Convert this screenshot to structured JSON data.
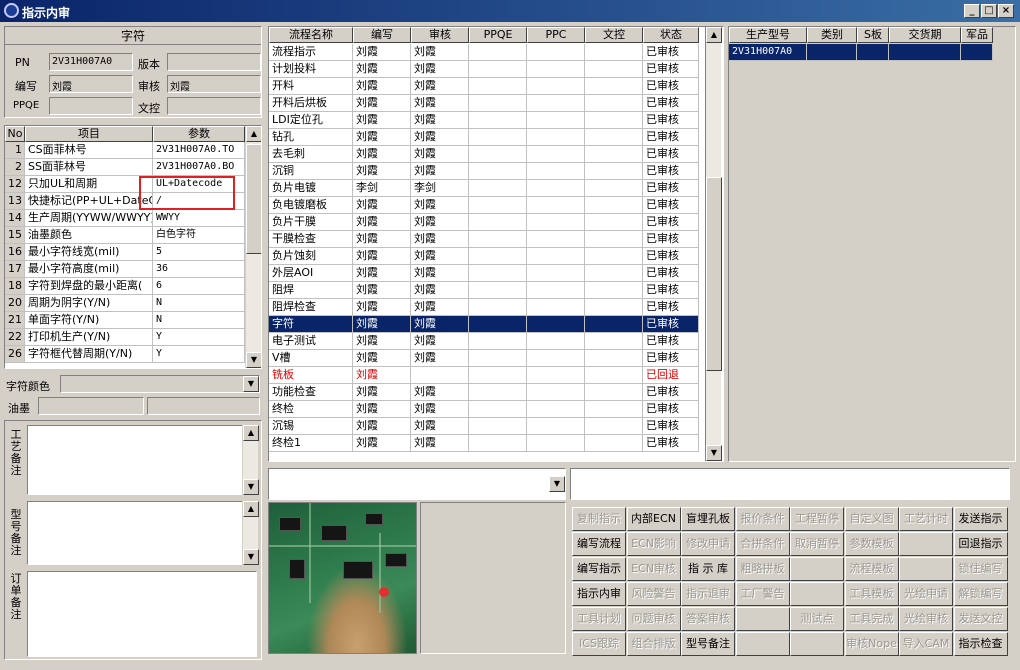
{
  "window": {
    "title": "指示内审",
    "buttons": [
      "_",
      "□",
      "×"
    ]
  },
  "header": {
    "section_title": "字符",
    "pn_label": "PN",
    "pn_value": "2V31H007A0",
    "version_label": "版本",
    "version_value": "",
    "author_label": "编写",
    "author_value": "刘霞",
    "review_label": "审核",
    "review_value": "刘霞",
    "ppqe_label": "PPQE",
    "ppqe_value": "",
    "doc_label": "文控",
    "doc_value": ""
  },
  "params": {
    "columns": [
      "No",
      "项目",
      "参数"
    ],
    "rows": [
      {
        "no": "1",
        "item": "CS面菲林号",
        "value": "2V31H007A0.TO"
      },
      {
        "no": "2",
        "item": "SS面菲林号",
        "value": "2V31H007A0.BO"
      },
      {
        "no": "12",
        "item": "只加UL和周期",
        "value": "UL+Datecode"
      },
      {
        "no": "13",
        "item": "快捷标记(PP+UL+DateCo",
        "value": "/"
      },
      {
        "no": "14",
        "item": "生产周期(YYWW/WWYY)",
        "value": "WWYY"
      },
      {
        "no": "15",
        "item": "油墨颜色",
        "value": "白色字符"
      },
      {
        "no": "16",
        "item": "最小字符线宽(mil)",
        "value": "5"
      },
      {
        "no": "17",
        "item": "最小字符高度(mil)",
        "value": "36"
      },
      {
        "no": "18",
        "item": "字符到焊盘的最小距离(",
        "value": "6"
      },
      {
        "no": "20",
        "item": "周期为阴字(Y/N)",
        "value": "N"
      },
      {
        "no": "21",
        "item": "单面字符(Y/N)",
        "value": "N"
      },
      {
        "no": "22",
        "item": "打印机生产(Y/N)",
        "value": "Y"
      },
      {
        "no": "26",
        "item": "字符框代替周期(Y/N)",
        "value": "Y"
      }
    ]
  },
  "char_color": {
    "label": "字符颜色",
    "value": ""
  },
  "ink": {
    "label": "油墨",
    "value1": "",
    "value2": ""
  },
  "notes": {
    "process": "工艺备注",
    "model": "型号备注",
    "order": "订单备注"
  },
  "process": {
    "columns": [
      "流程名称",
      "编写",
      "审核",
      "PPQE",
      "PPC",
      "文控",
      "状态"
    ],
    "rows": [
      {
        "name": "流程指示",
        "author": "刘霞",
        "review": "刘霞",
        "status": "已审核"
      },
      {
        "name": "计划投料",
        "author": "刘霞",
        "review": "刘霞",
        "status": "已审核"
      },
      {
        "name": "开料",
        "author": "刘霞",
        "review": "刘霞",
        "status": "已审核"
      },
      {
        "name": "开料后烘板",
        "author": "刘霞",
        "review": "刘霞",
        "status": "已审核"
      },
      {
        "name": "LDI定位孔",
        "author": "刘霞",
        "review": "刘霞",
        "status": "已审核"
      },
      {
        "name": "钻孔",
        "author": "刘霞",
        "review": "刘霞",
        "status": "已审核"
      },
      {
        "name": "去毛刺",
        "author": "刘霞",
        "review": "刘霞",
        "status": "已审核"
      },
      {
        "name": "沉铜",
        "author": "刘霞",
        "review": "刘霞",
        "status": "已审核"
      },
      {
        "name": "负片电镀",
        "author": "李剑",
        "review": "李剑",
        "status": "已审核"
      },
      {
        "name": "负电镀磨板",
        "author": "刘霞",
        "review": "刘霞",
        "status": "已审核"
      },
      {
        "name": "负片干膜",
        "author": "刘霞",
        "review": "刘霞",
        "status": "已审核"
      },
      {
        "name": "干膜检查",
        "author": "刘霞",
        "review": "刘霞",
        "status": "已审核"
      },
      {
        "name": "负片蚀刻",
        "author": "刘霞",
        "review": "刘霞",
        "status": "已审核"
      },
      {
        "name": "外层AOI",
        "author": "刘霞",
        "review": "刘霞",
        "status": "已审核"
      },
      {
        "name": "阻焊",
        "author": "刘霞",
        "review": "刘霞",
        "status": "已审核"
      },
      {
        "name": "阻焊检查",
        "author": "刘霞",
        "review": "刘霞",
        "status": "已审核"
      },
      {
        "name": "字符",
        "author": "刘霞",
        "review": "刘霞",
        "status": "已审核"
      },
      {
        "name": "电子测试",
        "author": "刘霞",
        "review": "刘霞",
        "status": "已审核"
      },
      {
        "name": "V槽",
        "author": "刘霞",
        "review": "刘霞",
        "status": "已审核"
      },
      {
        "name": "铣板",
        "author": "刘霞",
        "review": "",
        "status": "已回退"
      },
      {
        "name": "功能检查",
        "author": "刘霞",
        "review": "刘霞",
        "status": "已审核"
      },
      {
        "name": "终检",
        "author": "刘霞",
        "review": "刘霞",
        "status": "已审核"
      },
      {
        "name": "沉锡",
        "author": "刘霞",
        "review": "刘霞",
        "status": "已审核"
      },
      {
        "name": "终检1",
        "author": "刘霞",
        "review": "刘霞",
        "status": "已审核"
      }
    ],
    "selected_index": 16,
    "returned_index": 19
  },
  "production": {
    "columns": [
      "生产型号",
      "类别",
      "S板",
      "交货期",
      "军品"
    ],
    "rows": [
      {
        "model": "2V31H007A0",
        "type": "",
        "s": "",
        "due": "",
        "mil": ""
      }
    ]
  },
  "buttons": [
    [
      "复制指示",
      "内部ECN",
      "盲埋孔板",
      "报价条件",
      "工程暂停",
      "自定义图",
      "工艺计时",
      "发送指示"
    ],
    [
      "编写流程",
      "ECN影响",
      "修改申请",
      "合拼条件",
      "取消暂停",
      "参数模板",
      "",
      "回退指示"
    ],
    [
      "编写指示",
      "ECN审核",
      "指 示 库",
      "粗略拼板",
      "",
      "流程模板",
      "",
      "锁住编写"
    ],
    [
      "指示内审",
      "风险警告",
      "指示退审",
      "工厂警告",
      "",
      "工具模板",
      "光绘申请",
      "解锁编写"
    ],
    [
      "工具计划",
      "问题审核",
      "答案审核",
      "",
      "测试点",
      "工具完成",
      "光绘审核",
      "发送文控"
    ],
    [
      "ICS跟踪",
      "组合排版",
      "型号备注",
      "",
      "",
      "审核Nope",
      "导入CAM",
      "指示检查"
    ]
  ],
  "enabled_buttons": [
    "内部ECN",
    "盲埋孔板",
    "发送指示",
    "编写流程",
    "回退指示",
    "编写指示",
    "指 示 库",
    "指示内审",
    "型号备注",
    "指示检查"
  ],
  "colors": {
    "selection": "#0a246a",
    "returned": "#e00000",
    "highlight_box": "#e02020"
  }
}
